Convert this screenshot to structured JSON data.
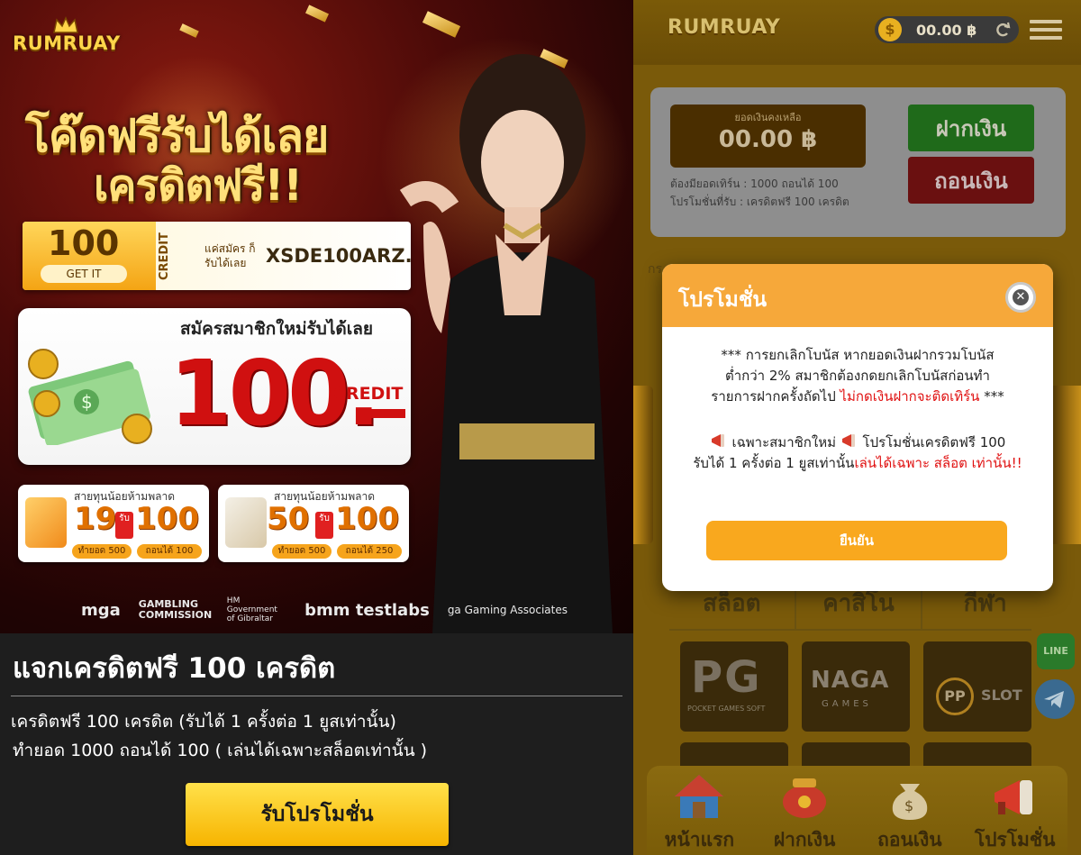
{
  "left": {
    "logo": "RUMRUAY",
    "headline_line1": "โค๊ดฟรีรับได้เลย",
    "headline_line2": "เครดิตฟรี!!",
    "code_card": {
      "amount": "100",
      "get_it": "GET IT",
      "credit_label": "CREDIT",
      "small_text": "แค่สมัคร ก็รับได้เลย",
      "code": "XSDE100ARZ..."
    },
    "signup_card": {
      "title": "สมัครสมาชิกใหม่รับได้เลย",
      "amount": "100.",
      "credit": "CREDIT"
    },
    "mini_cards": [
      {
        "title": "สายทุนน้อยห้ามพลาด",
        "a": "19",
        "rub": "รับ",
        "b": "100",
        "pill1": "ทำยอด 500",
        "pill2": "ถอนได้ 100"
      },
      {
        "title": "สายทุนน้อยห้ามพลาด",
        "a": "50",
        "rub": "รับ",
        "b": "100",
        "pill1": "ทำยอด 500",
        "pill2": "ถอนได้ 250"
      }
    ],
    "partners": [
      "mga",
      "GAMBLING COMMISSION",
      "HM Government of Gibraltar",
      "bmm testlabs",
      "ga Gaming Associates"
    ],
    "promo_title": "แจกเครดิตฟรี 100 เครดิต",
    "promo_line1": "เครดิตฟรี 100 เครดิต (รับได้ 1 ครั้งต่อ 1 ยูสเท่านั้น)",
    "promo_line2": "ทำยอด 1000 ถอนได้ 100 ( เล่นได้เฉพาะสล็อตเท่านั้น )",
    "promo_button": "รับโปรโมชั่น"
  },
  "right": {
    "logo": "RUMRUAY",
    "balance": "00.00 ฿",
    "coin_symbol": "$",
    "wallet": {
      "label": "ยอดเงินคงเหลือ",
      "amount": "00.00 ฿",
      "note1": "ต้องมียอดเทิร์น : 1000 ถอนได้ 100",
      "note2": "โปรโมชั่นที่รับ : เครดิตฟรี 100 เครดิต",
      "deposit": "ฝากเงิน",
      "withdraw": "ถอนเงิน"
    },
    "section_label": "กร...",
    "categories": [
      "สล็อต",
      "คาสิโน",
      "กีฬา"
    ],
    "providers": {
      "pg_big": "PG",
      "pg_small": "POCKET GAMES SOFT",
      "naga_big": "NAGA",
      "naga_small": "GAMES",
      "pp_circle": "PP",
      "pp_text": "SLOT"
    },
    "side_line": "LINE",
    "nav": [
      "หน้าแรก",
      "ฝากเงิน",
      "ถอนเงิน",
      "โปรโมชั่น"
    ],
    "modal": {
      "title": "โปรโมชั่น",
      "close": "✕",
      "p1_line1": "*** การยกเลิกโบนัส หากยอดเงินฝากรวมโบนัส",
      "p1_line2": "ต่ำกว่า 2% สมาชิกต้องกดยกเลิกโบนัสก่อนทำ",
      "p1_line3_a": "รายการฝากครั้งถัดไป ",
      "p1_line3_red": "ไม่กดเงินฝากจะติดเทิร์น",
      "p1_line3_b": " ***",
      "p2_line1_a": "เฉพาะสมาชิกใหม่",
      "p2_line1_b": "โปรโมชั่นเครดิตฟรี 100",
      "p2_line2_a": "รับได้ 1 ครั้งต่อ 1 ยูสเท่านั้น",
      "p2_line2_red": "เล่นได้เฉพาะ สล็อต เท่านั้น!!",
      "confirm": "ยืนยัน"
    }
  }
}
